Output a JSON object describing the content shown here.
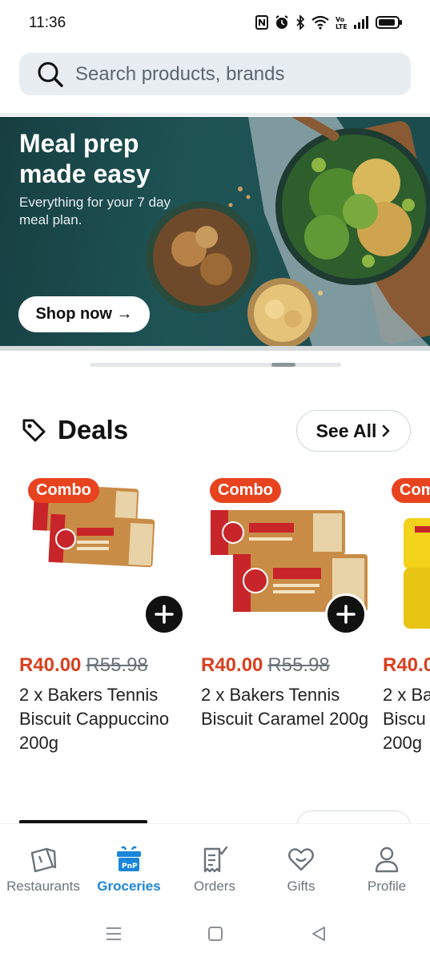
{
  "status_bar": {
    "time": "11:36",
    "icons": [
      "nfc-icon",
      "alarm-icon",
      "bluetooth-icon",
      "wifi-icon",
      "volte-icon",
      "signal-icon",
      "battery-icon"
    ]
  },
  "search": {
    "placeholder": "Search products, brands"
  },
  "banner": {
    "title": "Meal prep made easy",
    "subtitle": "Everything for your 7 day meal plan.",
    "cta_label": "Shop now →"
  },
  "carousel": {
    "active_index": 1
  },
  "deals": {
    "title": "Deals",
    "see_all_label": "See All",
    "products": [
      {
        "badge": "Combo",
        "price": "R40.00",
        "old_price": "R55.98",
        "name": "2 x Bakers Tennis Biscuit Cappuccino 200g"
      },
      {
        "badge": "Combo",
        "price": "R40.00",
        "old_price": "R55.98",
        "name": "2 x Bakers Tennis Biscuit Caramel 200g"
      },
      {
        "badge": "Com",
        "price": "R40.0",
        "old_price": "",
        "name": "2 x Ba Biscu 200g"
      }
    ]
  },
  "bottom_nav": {
    "items": [
      {
        "label": "Restaurants",
        "icon": "restaurant-bag-icon",
        "active": false
      },
      {
        "label": "Groceries",
        "icon": "groceries-icon",
        "active": true
      },
      {
        "label": "Orders",
        "icon": "orders-receipt-icon",
        "active": false
      },
      {
        "label": "Gifts",
        "icon": "gifts-heart-icon",
        "active": false
      },
      {
        "label": "Profile",
        "icon": "profile-icon",
        "active": false
      }
    ]
  },
  "colors": {
    "accent_blue": "#1a86d9",
    "deal_red": "#e8431f",
    "banner_green": "#1f5455"
  }
}
